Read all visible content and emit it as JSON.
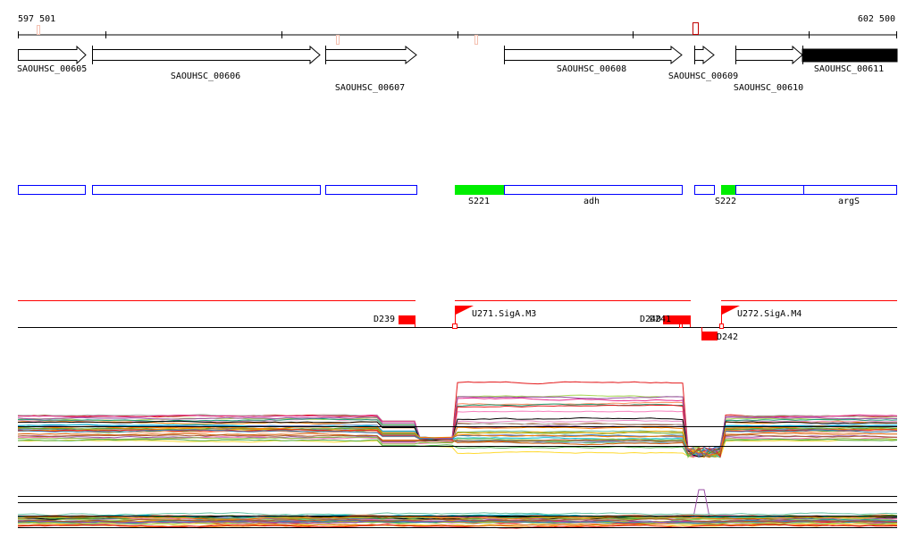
{
  "ruler": {
    "start_label": "597 501",
    "end_label": "602 500"
  },
  "genes": [
    {
      "name": "SAOUHSC_00605"
    },
    {
      "name": "SAOUHSC_00606"
    },
    {
      "name": "SAOUHSC_00607"
    },
    {
      "name": "SAOUHSC_00608"
    },
    {
      "name": "SAOUHSC_00609"
    },
    {
      "name": "SAOUHSC_00610"
    },
    {
      "name": "SAOUHSC_00611"
    }
  ],
  "annotations": [
    {
      "label": "S221"
    },
    {
      "label": "adh"
    },
    {
      "label": "S222"
    },
    {
      "label": "argS"
    }
  ],
  "features": {
    "d239": "D239",
    "u271": "U271.SigA.M3",
    "d240": "D240",
    "d241": "D241",
    "d242": "D242",
    "u272": "U272.SigA.M4"
  },
  "colors": {
    "feature": "#ff0000",
    "box": "#0000ff",
    "highlight": "#00ee00"
  }
}
